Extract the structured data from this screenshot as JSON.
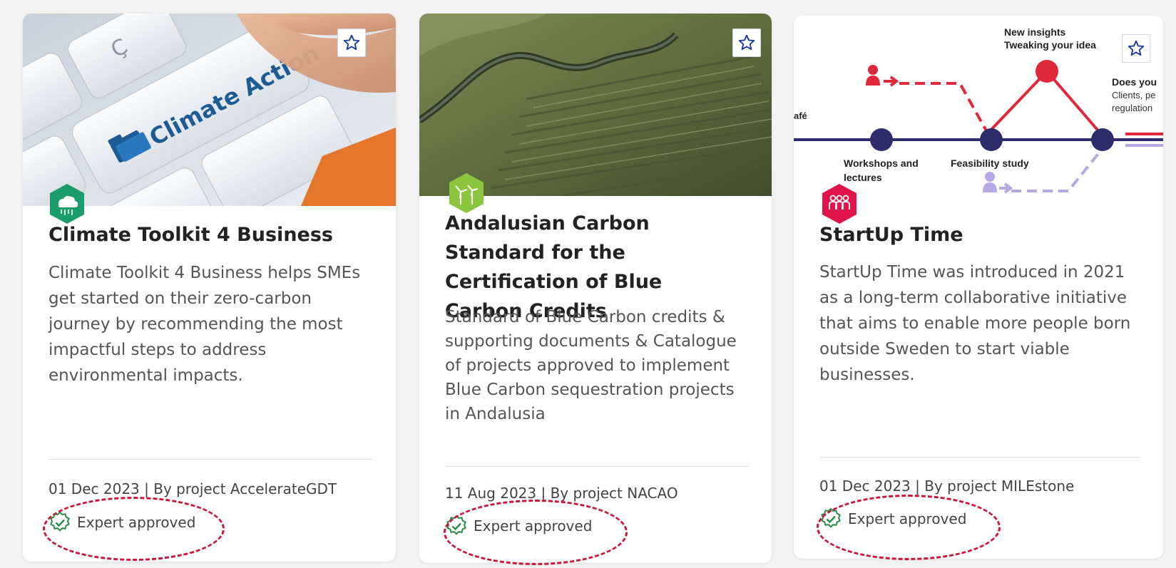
{
  "cards": [
    {
      "title": "Climate Toolkit 4 Business",
      "description": "Climate Toolkit 4 Business helps SMEs get started on their zero-carbon journey by recommending the most impactful steps to address environmental impacts.",
      "meta": "01 Dec 2023 | By project AccelerateGDT",
      "badge_label": "Expert approved",
      "image_key_text": "Climate Action",
      "category_icon": "cloud-icon",
      "category_color": "#1a9c6c"
    },
    {
      "title": "Andalusian Carbon Standard for the Certification of Blue Carbon Credits",
      "description": "Standard of Blue Carbon credits & supporting documents & Catalogue of projects approved to implement Blue Carbon sequestration projects in Andalusia",
      "meta": "11 Aug 2023 | By project NACAO",
      "badge_label": "Expert approved",
      "category_icon": "wind-turbine-icon",
      "category_color": "#8cc63f"
    },
    {
      "title": "StartUp Time",
      "description": "StartUp Time was introduced in 2021 as a long-term collaborative initiative that aims to enable more people born outside Sweden to start viable businesses.",
      "meta": "01 Dec 2023 | By project MILEstone",
      "badge_label": "Expert approved",
      "category_icon": "people-icon",
      "category_color": "#e0134a",
      "image_labels": {
        "new_insights": "New insights",
        "tweaking": "Tweaking your idea",
        "does_you": "Does you",
        "clients": "Clients, pe",
        "regulation": "regulation",
        "cafe": "afé",
        "workshops": "Workshops and",
        "lectures": "lectures",
        "feasibility": "Feasibility study"
      }
    }
  ],
  "colors": {
    "star": "#1f3f9a",
    "approved_icon": "#2b8a4a",
    "highlight": "#c8193c",
    "timeline_navy": "#2d2d6b",
    "timeline_red": "#e0283c",
    "timeline_lilac": "#b6a8e3"
  }
}
